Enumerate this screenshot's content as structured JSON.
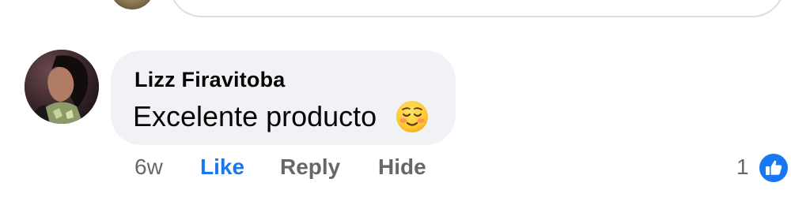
{
  "comment": {
    "author": "Lizz Firavitoba",
    "text": "Excelente producto",
    "emoji_icon": "smiling-face-icon",
    "actions": {
      "time": "6w",
      "like": "Like",
      "reply": "Reply",
      "hide": "Hide"
    },
    "reactions": {
      "count": "1",
      "icon": "thumbs-up-icon"
    }
  },
  "colors": {
    "bubble": "#f0f2f5",
    "primary_text": "#050505",
    "secondary_text": "#65676b",
    "like_blue": "#1877f2"
  }
}
